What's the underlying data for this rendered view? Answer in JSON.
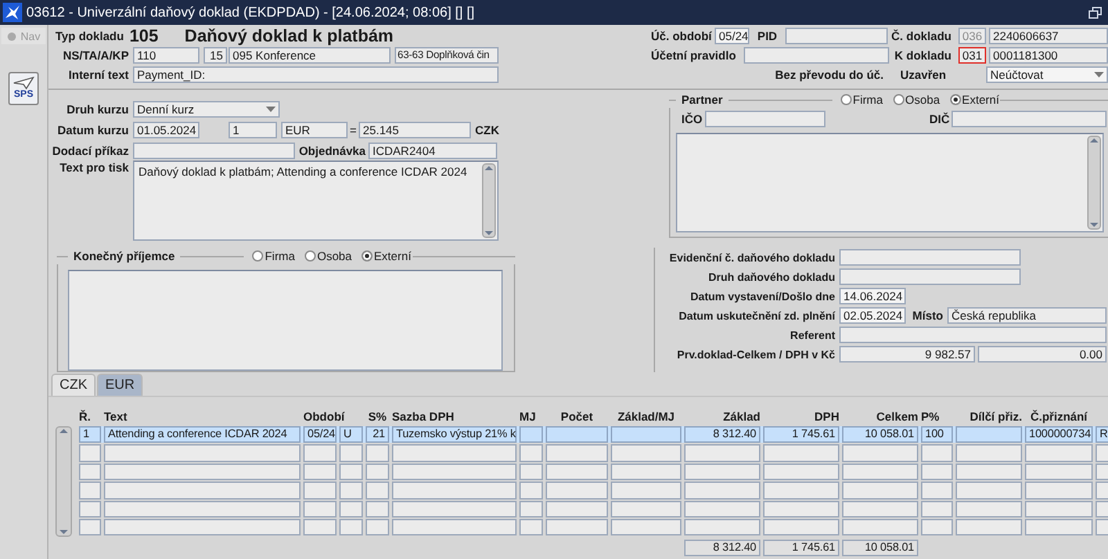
{
  "window": {
    "title": "03612 - Univerzální daňový doklad (EKDPDAD) - [24.06.2024; 08:06] [] []"
  },
  "sidebar": {
    "nav": {
      "label": "Nav",
      "disabled": true
    },
    "sps_label": "SPS"
  },
  "header": {
    "doc_type_label": "Typ dokladu",
    "doc_type_code": "105",
    "doc_type_name": "Daňový doklad k platbám",
    "ns_label": "NS/TA/A/KP",
    "ns_fields": [
      "110",
      "15",
      "095 Konference",
      "63-63 Doplňková čin"
    ],
    "internal_text_label": "Interní text",
    "internal_text": "Payment_ID:",
    "period_label": "Úč. období",
    "period": "05/24",
    "pid_label": "PID",
    "doc_no_label": "Č. dokladu",
    "doc_no_prefix": "036",
    "doc_no_prefix_disabled": true,
    "doc_no": "2240606637",
    "rule_label": "Účetní pravidlo",
    "ref_doc_label": "K dokladu",
    "ref_doc_prefix": "031",
    "ref_doc_prefix_flagged": true,
    "ref_doc": "0001181300",
    "no_transfer_label": "Bez převodu do úč.",
    "closed_label": "Uzavřen",
    "closed_value": "Neúčtovat"
  },
  "exchange": {
    "rate_type_label": "Druh kurzu",
    "rate_type": "Denní kurz",
    "rate_date_label": "Datum kurzu",
    "rate_date": "01.05.2024",
    "amount": "1",
    "currency": "EUR",
    "equals": "=",
    "rate": "25.145",
    "target_currency": "CZK",
    "delivery_label": "Dodací příkaz",
    "order_label": "Objednávka",
    "order": "ICDAR2404",
    "print_text_label": "Text pro tisk",
    "print_text": "Daňový doklad k platbám; Attending a conference ICDAR 2024"
  },
  "recipient": {
    "title": "Konečný příjemce",
    "options": [
      {
        "label": "Firma",
        "selected": false
      },
      {
        "label": "Osoba",
        "selected": false
      },
      {
        "label": "Externí",
        "selected": true
      }
    ]
  },
  "partner": {
    "title": "Partner",
    "options": [
      {
        "label": "Firma",
        "selected": false
      },
      {
        "label": "Osoba",
        "selected": false
      },
      {
        "label": "Externí",
        "selected": true
      }
    ],
    "ico_label": "IČO",
    "dic_label": "DIČ"
  },
  "tax": {
    "evidence_label": "Evidenční č. daňového dokladu",
    "type_label": "Druh daňového dokladu",
    "issue_date_label": "Datum vystavení/Došlo dne",
    "issue_date": "14.06.2024",
    "supply_date_label": "Datum uskutečnění zd. plnění",
    "supply_date": "02.05.2024",
    "place_label": "Místo",
    "place": "Česká republika",
    "referent_label": "Referent",
    "total_label": "Prv.doklad-Celkem / DPH v Kč",
    "total": "9 982.57",
    "vat": "0.00"
  },
  "tabs": [
    {
      "label": "CZK",
      "selected": true
    },
    {
      "label": "EUR",
      "selected": false
    }
  ],
  "table": {
    "columns": [
      "Ř.",
      "Text",
      "Období",
      null,
      "S%",
      "Sazba DPH",
      "MJ",
      "Počet",
      "Základ/MJ",
      "Základ",
      "DPH",
      "Celkem",
      "P%",
      "Dílčí přiz.",
      "Č.přiznání",
      null
    ],
    "rows": [
      {
        "selected": true,
        "cells": [
          "1",
          "Attending a conference ICDAR 2024",
          "05/24",
          "U",
          "21",
          "Tuzemsko výstup 21% k",
          null,
          null,
          null,
          "8 312.40",
          "1 745.61",
          "10 058.01",
          "100",
          null,
          "1000000734",
          "R"
        ]
      },
      {
        "selected": false
      },
      {
        "selected": false
      },
      {
        "selected": false
      },
      {
        "selected": false
      },
      {
        "selected": false
      }
    ],
    "totals": {
      "base": "8 312.40",
      "vat": "1 745.61",
      "total": "10 058.01"
    }
  }
}
